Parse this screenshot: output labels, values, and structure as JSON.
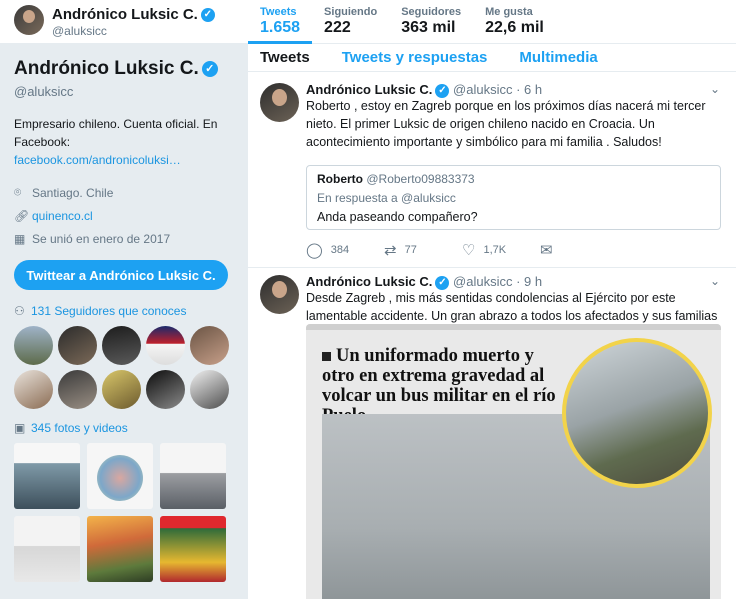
{
  "header": {
    "name": "Andrónico Luksic C.",
    "handle": "@aluksicc",
    "stats": [
      {
        "label": "Tweets",
        "value": "1.658"
      },
      {
        "label": "Siguiendo",
        "value": "222"
      },
      {
        "label": "Seguidores",
        "value": "363 mil"
      },
      {
        "label": "Me gusta",
        "value": "22,6 mil"
      }
    ]
  },
  "profile": {
    "name": "Andrónico Luksic C.",
    "handle": "@aluksicc",
    "bio": "Empresario chileno. Cuenta oficial. En Facebook: ",
    "bio_link": "facebook.com/andronicoluksi…",
    "location": "Santiago. Chile",
    "website": "quinenco.cl",
    "joined": "Se unió en enero de 2017",
    "tweet_to_button": "Twittear a Andrónico Luksic C.",
    "followers_you_know": "131 Seguidores que conoces",
    "photos_videos": "345 fotos y videos"
  },
  "tabs": [
    "Tweets",
    "Tweets y respuestas",
    "Multimedia"
  ],
  "tweets": [
    {
      "name": "Andrónico Luksic C.",
      "handle": "@aluksicc",
      "time": "· 6 h",
      "text": "Roberto , estoy en Zagreb porque en los próximos días nacerá mi tercer nieto. El primer Luksic de origen chileno nacido en Croacia. Un acontecimiento importante y simbólico para mi familia . Saludos!",
      "quote": {
        "name": "Roberto",
        "handle": "@Roberto09883373",
        "reply_to": "En respuesta a @aluksicc",
        "text": "Anda paseando compañero?"
      },
      "replies": "384",
      "retweets": "77",
      "likes": "1,7K"
    },
    {
      "name": "Andrónico Luksic C.",
      "handle": "@aluksicc",
      "time": "· 9 h",
      "text": "Desde Zagreb , mis más sentidas condolencias al Ejército por este lamentable accidente. Un gran abrazo a todos los afectados y sus familias .",
      "media_headline": "Un uniformado muerto y otro en extrema gravedad al volcar un bus militar en el río Puelo"
    }
  ],
  "colors": {
    "accent": "#1da1f2",
    "link": "#1b95e0",
    "muted": "#657786",
    "background": "#e6ecf0"
  }
}
